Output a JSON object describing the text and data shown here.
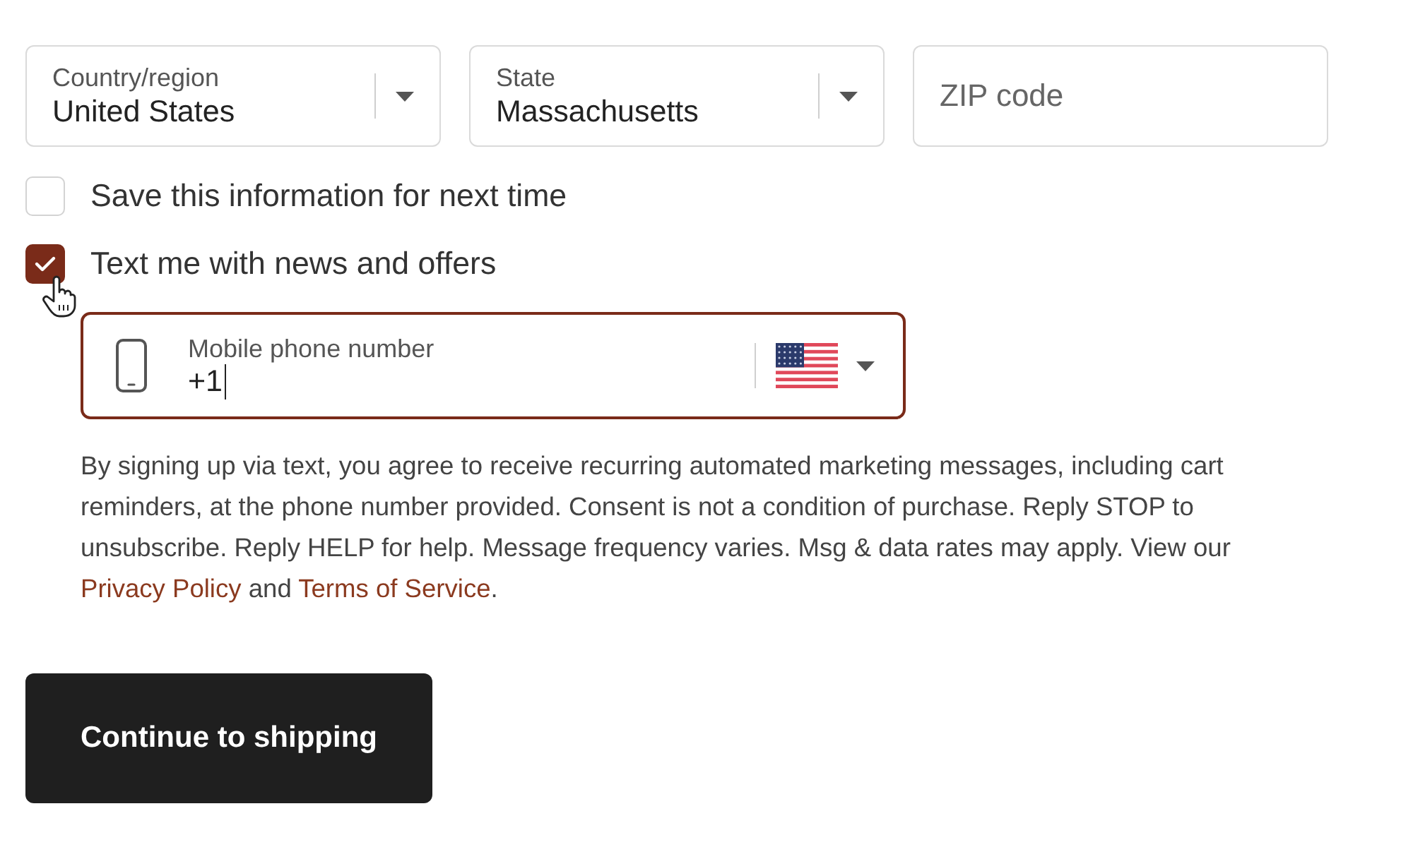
{
  "address_fields": [
    {
      "kind": "select",
      "label": "Country/region",
      "value": "United States"
    },
    {
      "kind": "select",
      "label": "State",
      "value": "Massachusetts"
    },
    {
      "kind": "text",
      "placeholder": "ZIP code"
    }
  ],
  "checkboxes": [
    {
      "label": "Save this information for next time",
      "checked": false
    },
    {
      "label": "Text me with news and offers",
      "checked": true
    }
  ],
  "phone_field": {
    "label": "Mobile phone number",
    "value": "+1",
    "focused": true
  },
  "consent": [
    {
      "kind": "text",
      "text": "By signing up via text, you agree to receive recurring automated marketing messages, including cart reminders, at the phone number provided. Consent is not a condition of purchase. Reply STOP to unsubscribe. Reply HELP for help. Message frequency varies. Msg & data rates may apply. View our "
    },
    {
      "kind": "link",
      "text": "Privacy Policy"
    },
    {
      "kind": "text",
      "text": " and "
    },
    {
      "kind": "link",
      "text": "Terms of Service"
    },
    {
      "kind": "text",
      "text": "."
    }
  ],
  "submit_button": {
    "label": "Continue to shipping"
  }
}
